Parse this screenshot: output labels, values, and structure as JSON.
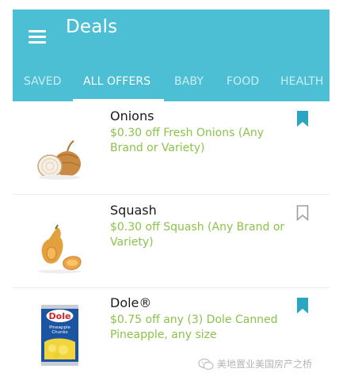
{
  "app_bar": {
    "title": "Deals",
    "menu_icon": "hamburger-menu-icon",
    "background_color": "#4cbfd4"
  },
  "tabs": [
    {
      "label": "SAVED",
      "active": false
    },
    {
      "label": "ALL OFFERS",
      "active": true
    },
    {
      "label": "BABY",
      "active": false
    },
    {
      "label": "FOOD",
      "active": false
    },
    {
      "label": "HEALTH",
      "active": false
    }
  ],
  "offers": [
    {
      "title": "Onions",
      "description": "$0.30 off Fresh Onions (Any Brand or Variety)",
      "image": "onion-image",
      "saved": true
    },
    {
      "title": "Squash",
      "description": "$0.30 off Squash (Any Brand or Variety)",
      "image": "butternut-squash-image",
      "saved": false
    },
    {
      "title": "Dole®",
      "description": "$0.75 off any  (3) Dole Canned Pineapple, any size",
      "image": "dole-pineapple-can-image",
      "saved": true
    }
  ],
  "watermark": {
    "text": "美地置业美国房产之桥",
    "icon": "wechat-icon"
  },
  "colors": {
    "accent": "#4cbfd4",
    "offer_text": "#8bc34a",
    "bookmark_saved": "#2aa6c2",
    "bookmark_unsaved": "#9e9e9e"
  }
}
